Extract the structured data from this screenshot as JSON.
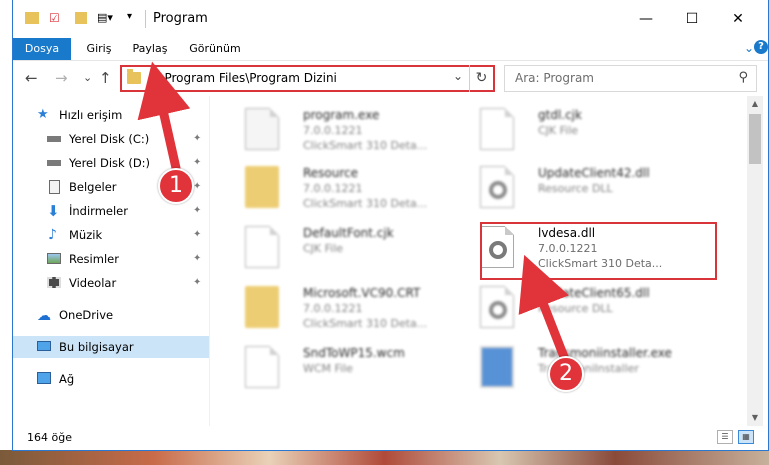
{
  "window": {
    "title": "Program",
    "minimize": "—",
    "maximize": "☐",
    "close": "✕"
  },
  "ribbon": {
    "tabs": [
      "Dosya",
      "Giriş",
      "Paylaş",
      "Görünüm"
    ],
    "expand": "⌄",
    "help": "?"
  },
  "nav": {
    "back": "←",
    "forward": "→",
    "recent": "⌄",
    "up": "↑",
    "address": "C:\\Program Files\\Program Dizini",
    "address_dropdown": "⌄",
    "refresh": "↻",
    "search_placeholder": "Ara: Program",
    "search_icon": "⚲"
  },
  "sidebar": {
    "items": [
      {
        "label": "Hızlı erişim",
        "icon": "star-icon",
        "pinned": false
      },
      {
        "label": "Yerel Disk (C:)",
        "icon": "drive-icon",
        "pinned": true
      },
      {
        "label": "Yerel Disk (D:)",
        "icon": "drive-icon",
        "pinned": true
      },
      {
        "label": "Belgeler",
        "icon": "documents-icon",
        "pinned": true
      },
      {
        "label": "İndirmeler",
        "icon": "download-icon",
        "pinned": true
      },
      {
        "label": "Müzik",
        "icon": "music-icon",
        "pinned": true
      },
      {
        "label": "Resimler",
        "icon": "pictures-icon",
        "pinned": true
      },
      {
        "label": "Videolar",
        "icon": "videos-icon",
        "pinned": true
      },
      {
        "label": "OneDrive",
        "icon": "cloud-icon",
        "pinned": false
      },
      {
        "label": "Bu bilgisayar",
        "icon": "computer-icon",
        "pinned": false,
        "selected": true
      },
      {
        "label": "Ağ",
        "icon": "network-icon",
        "pinned": false
      }
    ],
    "pin_glyph": "📌"
  },
  "files": [
    {
      "name": "program.exe",
      "line2": "7.0.0.1221",
      "line3": "ClickSmart 310 Deta...",
      "type": "exe"
    },
    {
      "name": "gtdl.cjk",
      "line2": "CJK File",
      "line3": "",
      "type": "doc"
    },
    {
      "name": "Resource",
      "line2": "7.0.0.1221",
      "line3": "ClickSmart 310 Deta...",
      "type": "folder"
    },
    {
      "name": "UpdateClient42.dll",
      "line2": "Resource DLL",
      "line3": "",
      "type": "dll"
    },
    {
      "name": "DefaultFont.cjk",
      "line2": "CJK File",
      "line3": "",
      "type": "doc"
    },
    {
      "name": "lvdesa.dll",
      "line2": "7.0.0.1221",
      "line3": "ClickSmart 310 Deta...",
      "type": "dll",
      "highlighted": true
    },
    {
      "name": "Microsoft.VC90.CRT",
      "line2": "7.0.0.1221",
      "line3": "ClickSmart 310 Deta...",
      "type": "folder"
    },
    {
      "name": "UpdateClient65.dll",
      "line2": "Resource DLL",
      "line3": "",
      "type": "dll"
    },
    {
      "name": "SndToWP15.wcm",
      "line2": "WCM File",
      "line3": "",
      "type": "doc"
    },
    {
      "name": "Transmoniinstaller.exe",
      "line2": "TransmoniInstaller",
      "line3": "",
      "type": "exe"
    }
  ],
  "status": {
    "item_count": "164 öğe",
    "details_view": "☰",
    "icons_view": "▦"
  },
  "annotations": {
    "step1": "1",
    "step2": "2",
    "color": "#e0343a"
  }
}
